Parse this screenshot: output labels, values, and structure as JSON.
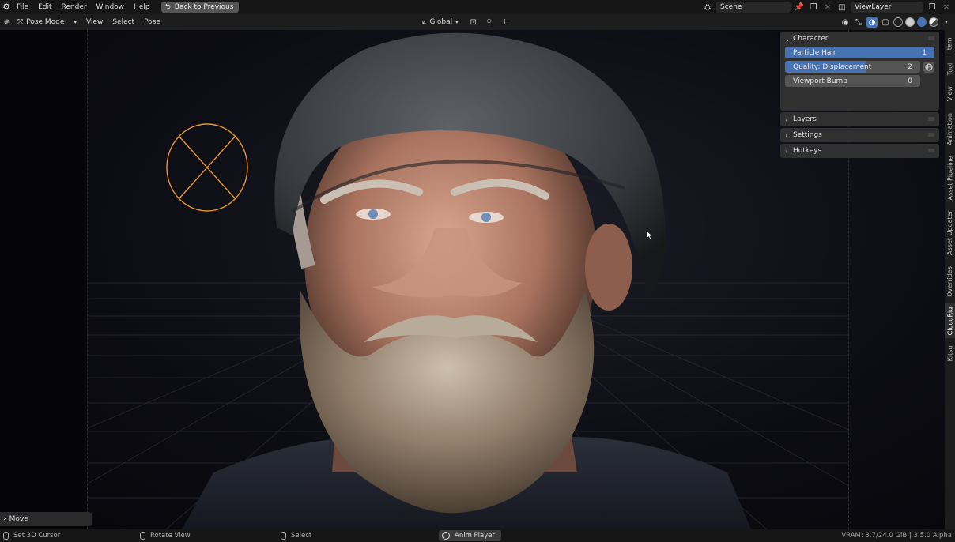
{
  "menu": {
    "items": [
      "File",
      "Edit",
      "Render",
      "Window",
      "Help"
    ],
    "back_button": "Back to Previous"
  },
  "topbar_right": {
    "scene": "Scene",
    "view_layer": "ViewLayer"
  },
  "header": {
    "mode": "Pose Mode",
    "menus": [
      "View",
      "Select",
      "Pose"
    ],
    "transform_orientation": "Global"
  },
  "sidebar": {
    "panels": [
      {
        "title": "Character",
        "expanded": true,
        "properties": [
          {
            "label": "Particle Hair",
            "value": "1",
            "fill": 1.0
          },
          {
            "label": "Quality: Displacement",
            "value": "2",
            "fill": 0.6
          },
          {
            "label": "Viewport Bump",
            "value": "0",
            "fill": 0.0
          }
        ]
      },
      {
        "title": "Layers",
        "expanded": false
      },
      {
        "title": "Settings",
        "expanded": false
      },
      {
        "title": "Hotkeys",
        "expanded": false
      }
    ],
    "tabs": [
      "Item",
      "Tool",
      "View",
      "Animation",
      "Asset Pipeline",
      "Asset Updater",
      "Overrides",
      "CloudRig",
      "Kitsu"
    ],
    "active_tab": "CloudRig"
  },
  "operator_panel": {
    "title": "Move"
  },
  "statusbar": {
    "set_cursor": "Set 3D Cursor",
    "rotate_view": "Rotate View",
    "select": "Select",
    "anim_player": "Anim Player",
    "info": "VRAM: 3.7/24.0 GiB | 3.5.0 Alpha"
  },
  "colors": {
    "accent": "#4772b3",
    "control_ring": "#e8962c"
  }
}
